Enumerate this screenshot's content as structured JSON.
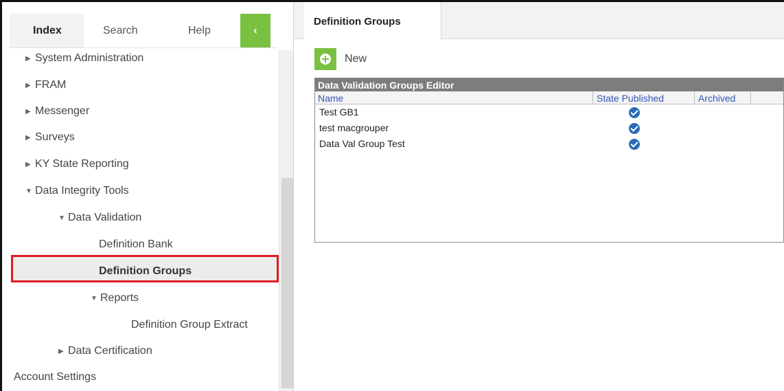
{
  "sidebar": {
    "tabs": [
      {
        "label": "Index"
      },
      {
        "label": "Search"
      },
      {
        "label": "Help"
      }
    ],
    "collapse_glyph": "‹",
    "tree": [
      {
        "label": "System Administration",
        "expanded": false
      },
      {
        "label": "FRAM",
        "expanded": false
      },
      {
        "label": "Messenger",
        "expanded": false
      },
      {
        "label": "Surveys",
        "expanded": false
      },
      {
        "label": "KY State Reporting",
        "expanded": false
      },
      {
        "label": "Data Integrity Tools",
        "expanded": true
      },
      {
        "label": "Data Validation",
        "expanded": true
      },
      {
        "label": "Definition Bank"
      },
      {
        "label": "Definition Groups",
        "selected": true
      },
      {
        "label": "Reports",
        "expanded": true
      },
      {
        "label": "Definition Group Extract"
      },
      {
        "label": "Data Certification",
        "expanded": false
      },
      {
        "label": "Account Settings"
      }
    ]
  },
  "main": {
    "tab_label": "Definition Groups",
    "new_label": "New",
    "editor": {
      "title": "Data Validation Groups Editor",
      "columns": [
        "Name",
        "State Published",
        "Archived"
      ],
      "rows": [
        {
          "name": "Test GB1",
          "state_published": true,
          "archived": false
        },
        {
          "name": "test macgrouper",
          "state_published": true,
          "archived": false
        },
        {
          "name": "Data Val Group Test",
          "state_published": true,
          "archived": false
        }
      ]
    }
  },
  "colors": {
    "accent_green": "#7ac142",
    "selection_border": "#e01a22",
    "check_blue": "#2a6bb5",
    "header_gray": "#7d7d7d",
    "column_link": "#3355bb"
  },
  "icons": {
    "collapse": "chevron-left-icon",
    "new": "plus-circle-icon",
    "published": "check-circle-icon",
    "collapsed_node": "triangle-right-icon",
    "expanded_node": "triangle-down-icon"
  }
}
